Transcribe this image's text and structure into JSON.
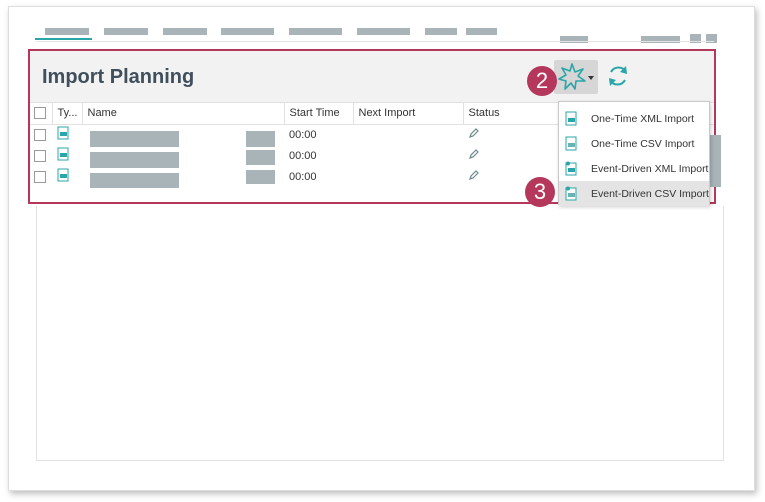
{
  "panel": {
    "title": "Import Planning",
    "badges": {
      "step_add": "2",
      "step_menu": "3"
    }
  },
  "table": {
    "headers": [
      "Ty...",
      "Name",
      "Start Time",
      "Next Import",
      "Status"
    ],
    "rows": [
      {
        "start_time": "00:00"
      },
      {
        "start_time": "00:00"
      },
      {
        "start_time": "00:00"
      }
    ]
  },
  "menu": {
    "items": [
      {
        "label": "One-Time XML Import",
        "icon": "xml-file-icon"
      },
      {
        "label": "One-Time CSV Import",
        "icon": "csv-file-icon"
      },
      {
        "label": "Event-Driven XML Import",
        "icon": "event-xml-file-icon"
      },
      {
        "label": "Event-Driven CSV Import",
        "icon": "event-csv-file-icon",
        "highlighted": true
      }
    ]
  },
  "colors": {
    "accent": "#2aa6a9",
    "highlight_border": "#b5385c",
    "title": "#3f4f5c"
  }
}
